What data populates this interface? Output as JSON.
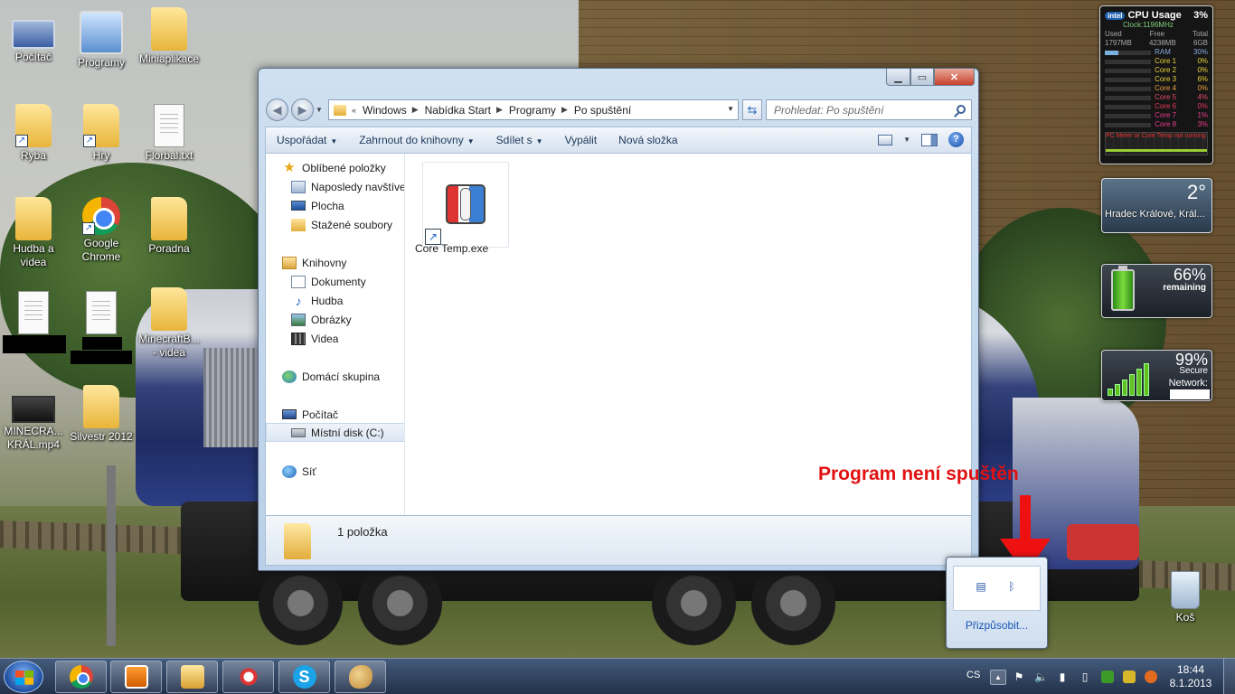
{
  "desktop": {
    "icons": [
      {
        "label": "Počítač"
      },
      {
        "label": "Programy"
      },
      {
        "label": "Miniaplikace"
      },
      {
        "label": "Ryba"
      },
      {
        "label": "Hry"
      },
      {
        "label": "Florbal.txt"
      },
      {
        "label": "Hudba a videa"
      },
      {
        "label": "Google Chrome"
      },
      {
        "label": "Poradna"
      },
      {
        "label": "MinecraftB... - videa"
      },
      {
        "label": "MINECRA... KRÁL.mp4"
      },
      {
        "label": "Silvestr 2012"
      },
      {
        "label": "Koš"
      }
    ]
  },
  "gadgets": {
    "cpu": {
      "brand": "intel",
      "title": "CPU Usage",
      "usage": "3%",
      "clock": "Clock:1196MHz",
      "headers": [
        "Used",
        "Free",
        "Total"
      ],
      "values": [
        "1797MB",
        "4238MB",
        "6GB"
      ],
      "ram": {
        "label": "RAM",
        "value": "30%"
      },
      "cores": [
        {
          "name": "Core 1",
          "value": "0%",
          "color": "#e8d23a"
        },
        {
          "name": "Core 2",
          "value": "0%",
          "color": "#e8d23a"
        },
        {
          "name": "Core 3",
          "value": "6%",
          "color": "#e8d23a"
        },
        {
          "name": "Core 4",
          "value": "0%",
          "color": "#e8a23a"
        },
        {
          "name": "Core 5",
          "value": "4%",
          "color": "#e84a6a"
        },
        {
          "name": "Core 6",
          "value": "0%",
          "color": "#e83a5a"
        },
        {
          "name": "Core 7",
          "value": "1%",
          "color": "#e83a8a"
        },
        {
          "name": "Core 8",
          "value": "3%",
          "color": "#e83a8a"
        }
      ],
      "footer": "PC Meter or Core Temp not running"
    },
    "weather": {
      "temp": "2°",
      "city": "Hradec Králové, Král..."
    },
    "battery": {
      "percent": "66%",
      "label": "remaining",
      "level": 0.66
    },
    "network": {
      "percent": "99%",
      "label1": "Secure",
      "label2": "Network:"
    }
  },
  "explorer": {
    "breadcrumbs": [
      "Windows",
      "Nabídka Start",
      "Programy",
      "Po spuštění"
    ],
    "breadcrumb_prefix": "«",
    "search_placeholder": "Prohledat: Po spuštění",
    "toolbar": [
      {
        "label": "Uspořádat",
        "dropdown": true
      },
      {
        "label": "Zahrnout do knihovny",
        "dropdown": true
      },
      {
        "label": "Sdílet s",
        "dropdown": true
      },
      {
        "label": "Vypálit",
        "dropdown": false
      },
      {
        "label": "Nová složka",
        "dropdown": false
      }
    ],
    "nav": {
      "favorites": "Oblíbené položky",
      "recent": "Naposledy navštívené",
      "desktop": "Plocha",
      "downloads": "Stažené soubory",
      "libraries": "Knihovny",
      "documents": "Dokumenty",
      "music": "Hudba",
      "pictures": "Obrázky",
      "videos": "Videa",
      "homegroup": "Domácí skupina",
      "computer": "Počítač",
      "local_disk": "Místní disk (C:)",
      "network": "Síť"
    },
    "files": [
      {
        "name": "Core Temp.exe"
      }
    ],
    "status": "1 položka"
  },
  "annotation": {
    "text": "Program není spuštěn",
    "color": "#e11111"
  },
  "tray_popup": {
    "link": "Přizpůsobit..."
  },
  "taskbar": {
    "language": "CS",
    "time": "18:44",
    "date": "8.1.2013"
  }
}
